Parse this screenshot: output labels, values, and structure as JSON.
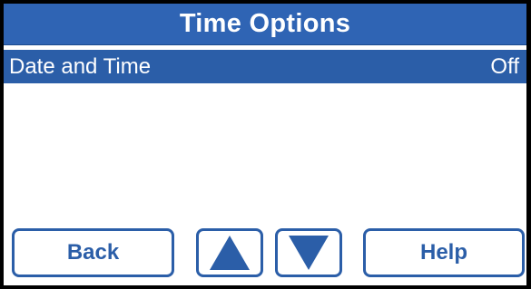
{
  "header": {
    "title": "Time Options"
  },
  "menu": {
    "items": [
      {
        "label": "Date and Time",
        "value": "Off"
      }
    ]
  },
  "footer": {
    "back_label": "Back",
    "help_label": "Help",
    "up_icon": "up-arrow-icon",
    "down_icon": "down-arrow-icon"
  },
  "colors": {
    "accent": "#2b5ea8",
    "title_bar": "#2f64b4",
    "background": "#ffffff",
    "bezel": "#000000"
  }
}
